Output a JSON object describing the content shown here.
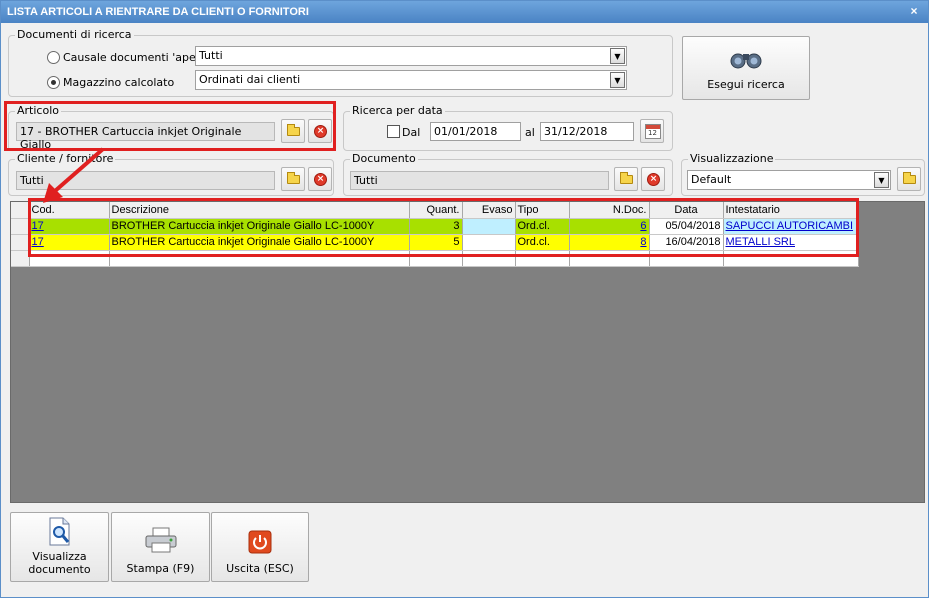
{
  "window": {
    "title": "LISTA ARTICOLI A RIENTRARE DA CLIENTI O FORNITORI",
    "close_glyph": "×"
  },
  "documenti": {
    "legend": "Documenti di ricerca",
    "causale_label": "Causale documenti 'aperti'",
    "causale_value": "Tutti",
    "magazzino_label": "Magazzino calcolato",
    "magazzino_value": "Ordinati dai clienti"
  },
  "esegui_label": "Esegui ricerca",
  "articolo": {
    "legend": "Articolo",
    "value": "17 - BROTHER Cartuccia inkjet Originale Giallo"
  },
  "ricerca_data": {
    "legend": "Ricerca per data",
    "dal_label": "Dal",
    "dal_value": "01/01/2018",
    "al_label": "al",
    "al_value": "31/12/2018",
    "cal_text": "12"
  },
  "cliente": {
    "legend": "Cliente / fornitore",
    "value": "Tutti"
  },
  "documento": {
    "legend": "Documento",
    "value": "Tutti"
  },
  "visualizzazione": {
    "legend": "Visualizzazione",
    "value": "Default"
  },
  "table": {
    "headers": [
      "Cod.",
      "Descrizione",
      "Quant.",
      "Evaso",
      "Tipo",
      "N.Doc.",
      "Data",
      "Intestatario"
    ],
    "rows": [
      {
        "cod": "17",
        "descrizione": "BROTHER Cartuccia inkjet Originale Giallo LC-1000Y",
        "quant": "3",
        "evaso": "",
        "tipo": "Ord.cl.",
        "ndoc": "6",
        "data": "05/04/2018",
        "intestatario": "SAPUCCI AUTORICAMBI",
        "color": "#a8e000"
      },
      {
        "cod": "17",
        "descrizione": "BROTHER Cartuccia inkjet Originale Giallo LC-1000Y",
        "quant": "5",
        "evaso": "",
        "tipo": "Ord.cl.",
        "ndoc": "8",
        "data": "16/04/2018",
        "intestatario": "METALLI SRL",
        "color": "#ffff00"
      }
    ]
  },
  "buttons": {
    "visualizza_1": "Visualizza",
    "visualizza_2": "documento",
    "stampa": "Stampa (F9)",
    "uscita": "Uscita (ESC)"
  }
}
